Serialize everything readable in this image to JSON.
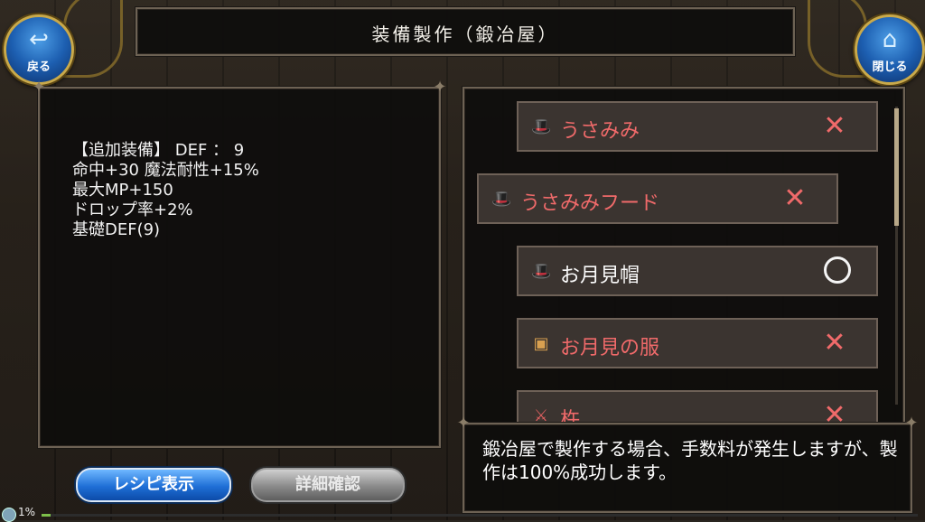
{
  "header": {
    "title": "装備製作（鍛冶屋）",
    "back_label": "戻る",
    "close_label": "閉じる"
  },
  "info": {
    "lines": [
      "【追加装備】 DEF ： 9",
      "命中+30 魔法耐性+15%",
      "最大MP+150",
      "ドロップ率+2%",
      "基礎DEF(9)"
    ]
  },
  "recipes": [
    {
      "name": "うさみみ",
      "icon": "hat-icon",
      "craftable": false
    },
    {
      "name": "うさみみフード",
      "icon": "hat-icon",
      "craftable": false
    },
    {
      "name": "お月見帽",
      "icon": "hat-icon",
      "craftable": true
    },
    {
      "name": "お月見の服",
      "icon": "armor-icon",
      "craftable": false
    },
    {
      "name": "杵",
      "icon": "weapon-icon",
      "craftable": false
    }
  ],
  "message": "鍛冶屋で製作する場合、手数料が発生しますが、製作は100%成功します。",
  "buttons": {
    "recipe_label": "レシピ表示",
    "details_label": "詳細確認"
  },
  "status": {
    "progress_text": "1%",
    "progress": 0.01
  },
  "colors": {
    "accent_blue": "#1f6fd6",
    "not_craftable": "#f06a6a",
    "craftable": "#fafafa"
  }
}
